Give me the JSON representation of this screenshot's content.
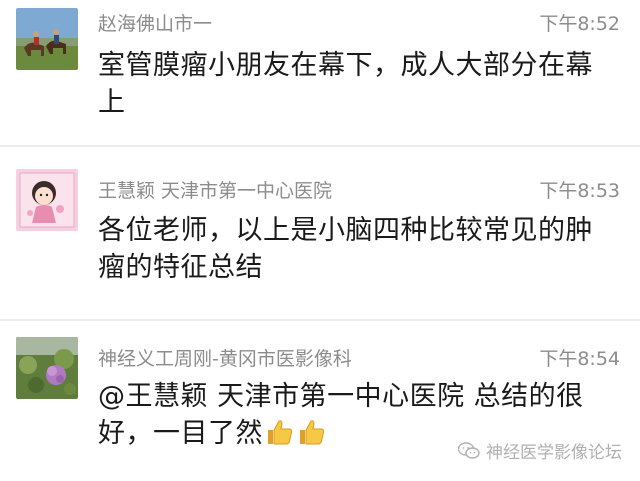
{
  "messages": [
    {
      "sender": "赵海佛山市一",
      "time": "下午8:52",
      "text": "室管膜瘤小朋友在幕下，成人大部分在幕上",
      "avatar": "horse-riders-photo"
    },
    {
      "sender": "王慧颖 天津市第一中心医院",
      "time": "下午8:53",
      "text": "各位老师，以上是小脑四种比较常见的肿瘤的特征总结",
      "avatar": "cartoon-girl-avatar"
    },
    {
      "sender": "神经义工周刚-黄冈市医影像科",
      "time": "下午8:54",
      "text": "@王慧颖 天津市第一中心医院 总结的很好，一目了然",
      "emoji": [
        "thumbs-up-emoji",
        "thumbs-up-emoji"
      ],
      "avatar": "flower-photo"
    }
  ],
  "watermark": {
    "text": "神经医学影像论坛",
    "icon": "wechat-icon"
  }
}
